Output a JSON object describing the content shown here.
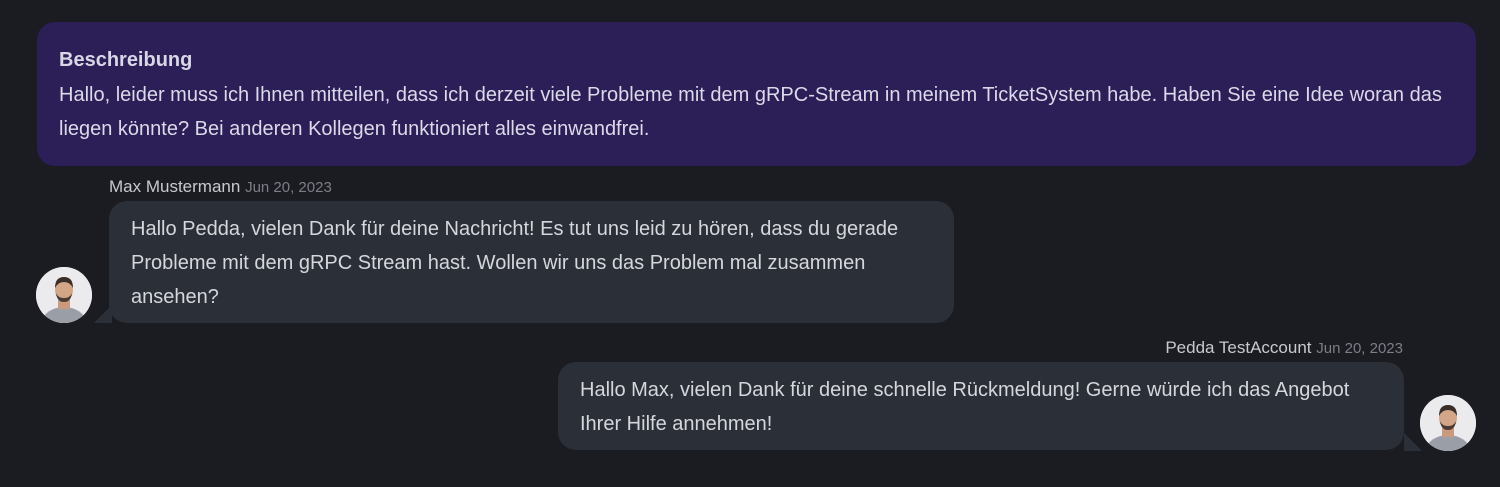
{
  "description": {
    "title": "Beschreibung",
    "text": "Hallo, leider muss ich Ihnen mitteilen, dass ich derzeit viele Probleme mit dem gRPC-Stream in meinem TicketSystem habe. Haben Sie eine Idee woran das liegen könnte? Bei anderen Kollegen funktioniert alles einwandfrei."
  },
  "messages": [
    {
      "author": "Max Mustermann",
      "date": "Jun 20, 2023",
      "text": "Hallo Pedda, vielen Dank für deine Nachricht! Es tut uns leid zu hören, dass du gerade Probleme mit dem gRPC Stream hast. Wollen wir uns das Problem mal zusammen ansehen?",
      "side": "left"
    },
    {
      "author": "Pedda TestAccount",
      "date": "Jun 20, 2023",
      "text": "Hallo Max, vielen Dank für deine schnelle Rückmeldung! Gerne würde ich das Angebot Ihrer Hilfe annehmen!",
      "side": "right"
    }
  ],
  "colors": {
    "background": "#1b1c22",
    "description_bg": "#2c1e57",
    "bubble_bg": "#2b2f37"
  },
  "icons": {
    "avatar": "user-avatar-photo"
  }
}
